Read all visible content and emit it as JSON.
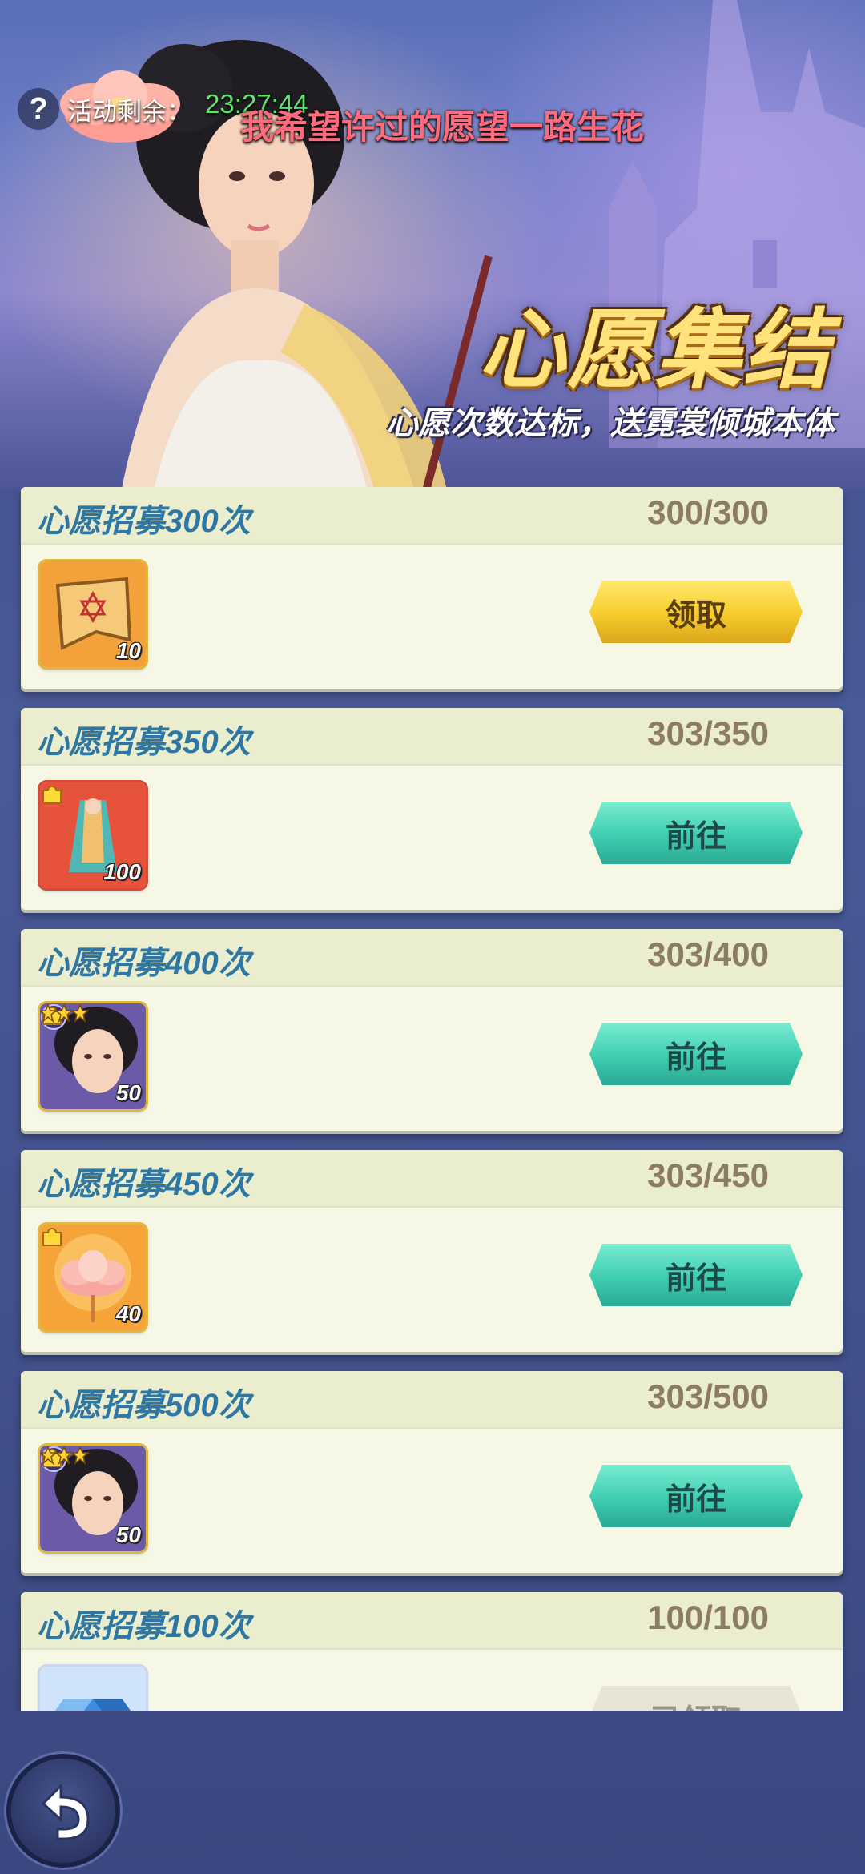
{
  "header": {
    "timer_label": "活动剩余：",
    "timer_value": "23:27:44",
    "danmaku": "我希望许过的愿望一路生花",
    "title": "心愿集结",
    "subtitle": "心愿次数达标，送霓裳倾城本体"
  },
  "tasks": [
    {
      "title": "心愿招募300次",
      "progress": "300/300",
      "button": "领取",
      "reward_count": "10"
    },
    {
      "title": "心愿招募350次",
      "progress": "303/350",
      "button": "前往",
      "reward_count": "100"
    },
    {
      "title": "心愿招募400次",
      "progress": "303/400",
      "button": "前往",
      "reward_count": "50"
    },
    {
      "title": "心愿招募450次",
      "progress": "303/450",
      "button": "前往",
      "reward_count": "40"
    },
    {
      "title": "心愿招募500次",
      "progress": "303/500",
      "button": "前往",
      "reward_count": "50"
    },
    {
      "title": "心愿招募100次",
      "progress": "100/100",
      "button": "已领取",
      "reward_count": ""
    }
  ],
  "colors": {
    "title_blue": "#2f77a3",
    "claim_yellow": "#f5cc2c",
    "go_teal": "#3fcdb0",
    "card_bg": "#f6f7e4"
  },
  "icons": [
    "help-icon",
    "scroll-icon",
    "robe-fragment-icon",
    "heroine-fragment-icon",
    "lotus-icon",
    "gem-icon",
    "back-arrow-icon"
  ]
}
